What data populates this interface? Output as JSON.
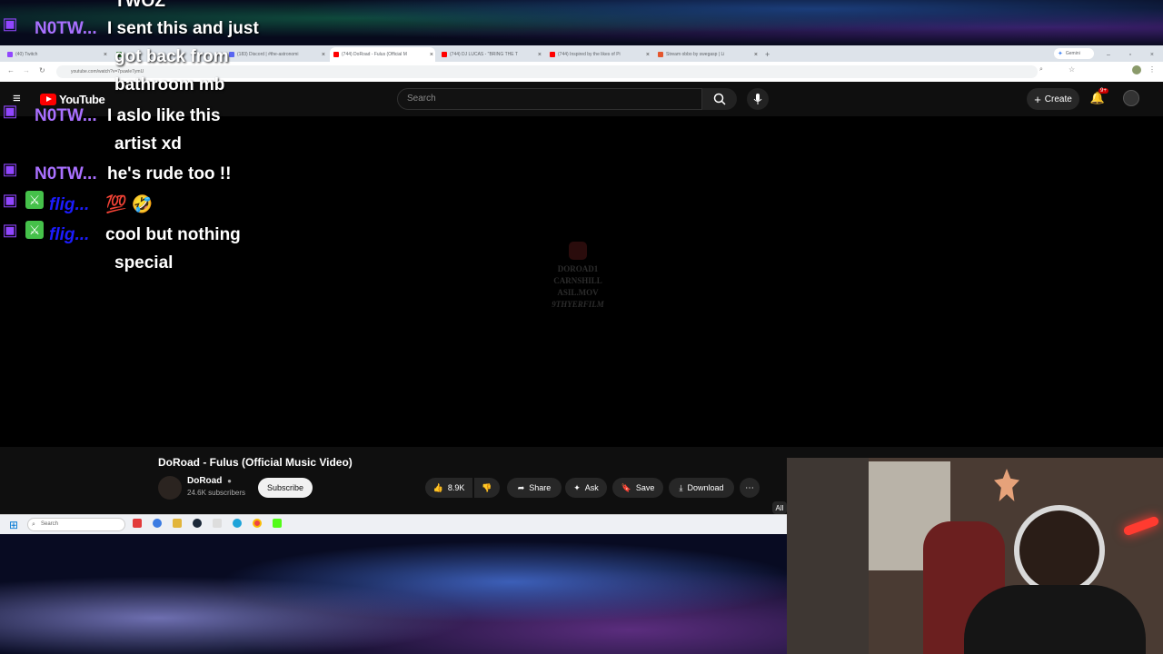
{
  "chat": {
    "messages": [
      {
        "user": "",
        "text": "TWOZ",
        "color": "#a970ff"
      },
      {
        "user": "N0TW...",
        "text": "I sent this and just",
        "color": "#a970ff"
      },
      {
        "user": "",
        "text": "got back from",
        "color": "#a970ff"
      },
      {
        "user": "",
        "text": "bathroom mb",
        "color": "#a970ff"
      },
      {
        "user": "N0TW...",
        "text": "I aslo like this",
        "color": "#a970ff"
      },
      {
        "user": "",
        "text": "artist xd",
        "color": "#a970ff"
      },
      {
        "user": "N0TW...",
        "text": "he's rude too !!",
        "color": "#a970ff"
      },
      {
        "user": "flig...",
        "text": "💯 🤣",
        "color": "#1c1cff"
      },
      {
        "user": "flig...",
        "text": "cool but nothing",
        "color": "#1c1cff"
      },
      {
        "user": "",
        "text": "special",
        "color": "#1c1cff"
      }
    ]
  },
  "browser": {
    "tabs": [
      {
        "label": "(40) Twitch",
        "color": "#9146ff"
      },
      {
        "label": "",
        "color": "#2e7d32"
      },
      {
        "label": "(183) Discord | #the-astronomi",
        "color": "#5865f2"
      },
      {
        "label": "(744) DoRoad - Fulus (Official M",
        "color": "#ff0000",
        "active": true
      },
      {
        "label": "(744) DJ LUCAS - \"BRING THE T",
        "color": "#ff0000"
      },
      {
        "label": "(744) Inspired by the likes of Pi",
        "color": "#ff0000"
      },
      {
        "label": "Stream obbo by swegasp | Li",
        "color": "#e4572e"
      }
    ],
    "gemini_label": "Gemini",
    "url": "youtube.com/watch?v=7puwle7ymU"
  },
  "youtube": {
    "logo_text": "YouTube",
    "search_placeholder": "Search",
    "create_label": "Create",
    "notif_badge": "9+",
    "watermark_lines": [
      "DOROAD1",
      "CARNSHILL",
      "ASIL.MOV",
      "9THYERFILM"
    ],
    "video_title": "DoRoad - Fulus (Official Music Video)",
    "channel_name": "DoRoad",
    "subscribers": "24.6K subscribers",
    "subscribe_label": "Subscribe",
    "like_count": "8.9K",
    "share_label": "Share",
    "ask_label": "Ask",
    "save_label": "Save",
    "download_label": "Download",
    "all_label": "All"
  },
  "taskbar": {
    "search_label": "Search"
  }
}
